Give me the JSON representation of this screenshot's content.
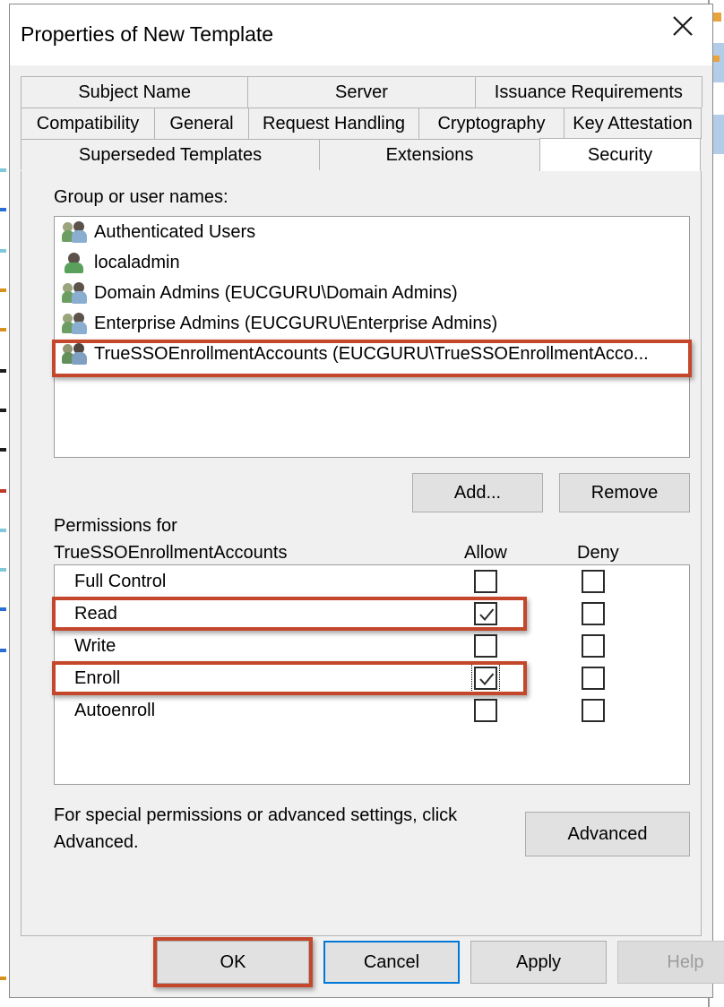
{
  "window": {
    "title": "Properties of New Template",
    "close_icon": "close-icon"
  },
  "tabs": {
    "row1": [
      {
        "label": "Subject Name",
        "selected": false
      },
      {
        "label": "Server",
        "selected": false
      },
      {
        "label": "Issuance Requirements",
        "selected": false
      }
    ],
    "row2": [
      {
        "label": "Compatibility",
        "selected": false
      },
      {
        "label": "General",
        "selected": false
      },
      {
        "label": "Request Handling",
        "selected": false
      },
      {
        "label": "Cryptography",
        "selected": false
      },
      {
        "label": "Key Attestation",
        "selected": false
      }
    ],
    "row3": [
      {
        "label": "Superseded Templates",
        "selected": false
      },
      {
        "label": "Extensions",
        "selected": false
      },
      {
        "label": "Security",
        "selected": true
      }
    ]
  },
  "security": {
    "group_list_label": "Group or user names:",
    "groups": [
      {
        "name": "Authenticated Users",
        "icon": "group-icon",
        "highlighted": false
      },
      {
        "name": "localadmin",
        "icon": "user-icon",
        "highlighted": false
      },
      {
        "name": "Domain Admins (EUCGURU\\Domain Admins)",
        "icon": "group-icon",
        "highlighted": false
      },
      {
        "name": "Enterprise Admins (EUCGURU\\Enterprise Admins)",
        "icon": "group-icon",
        "highlighted": false
      },
      {
        "name": "TrueSSOEnrollmentAccounts (EUCGURU\\TrueSSOEnrollmentAcco...",
        "icon": "group-icon",
        "highlighted": true
      }
    ],
    "add_label": "Add...",
    "remove_label": "Remove",
    "permissions_label_line1": "Permissions for",
    "permissions_label_line2": "TrueSSOEnrollmentAccounts",
    "allow_column": "Allow",
    "deny_column": "Deny",
    "permissions": [
      {
        "name": "Full Control",
        "allow": false,
        "deny": false,
        "highlighted": false,
        "focused": false
      },
      {
        "name": "Read",
        "allow": true,
        "deny": false,
        "highlighted": true,
        "focused": false
      },
      {
        "name": "Write",
        "allow": false,
        "deny": false,
        "highlighted": false,
        "focused": false
      },
      {
        "name": "Enroll",
        "allow": true,
        "deny": false,
        "highlighted": true,
        "focused": true
      },
      {
        "name": "Autoenroll",
        "allow": false,
        "deny": false,
        "highlighted": false,
        "focused": false
      }
    ],
    "footer_note": "For special permissions or advanced settings, click Advanced.",
    "advanced_label": "Advanced"
  },
  "commands": [
    {
      "label": "OK",
      "state": "highlighted"
    },
    {
      "label": "Cancel",
      "state": "focused"
    },
    {
      "label": "Apply",
      "state": "normal"
    },
    {
      "label": "Help",
      "state": "disabled"
    }
  ],
  "colors": {
    "annotation_red": "#c4472c",
    "focus_blue": "#0078d7",
    "dialog_face": "#f0f0f0",
    "selection_blue": "#b3ccea"
  }
}
